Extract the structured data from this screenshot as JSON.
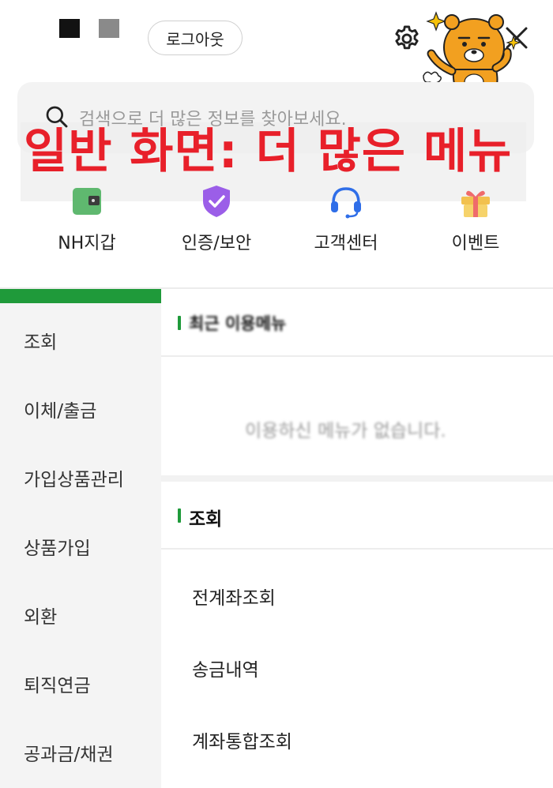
{
  "header": {
    "logout_label": "로그아웃"
  },
  "search": {
    "placeholder": "검색으로 더 많은 정보를 찾아보세요."
  },
  "banner": {
    "text": "일반 화면: 더 많은 메뉴"
  },
  "quick_menu": [
    {
      "label": "NH지갑",
      "icon": "wallet-icon",
      "color": "#5fb86f"
    },
    {
      "label": "인증/보안",
      "icon": "shield-check-icon",
      "color": "#9b5ee8"
    },
    {
      "label": "고객센터",
      "icon": "headset-icon",
      "color": "#2f6ee8"
    },
    {
      "label": "이벤트",
      "icon": "gift-icon",
      "color": "#f2c14e"
    }
  ],
  "sidebar": {
    "items": [
      {
        "label": "조회"
      },
      {
        "label": "이체/출금"
      },
      {
        "label": "가입상품관리"
      },
      {
        "label": "상품가입"
      },
      {
        "label": "외환"
      },
      {
        "label": "퇴직연금"
      },
      {
        "label": "공과금/채권"
      }
    ]
  },
  "main": {
    "recent_title": "최근 이용메뉴",
    "empty_message": "이용하신 메뉴가 없습니다.",
    "section_title": "조회",
    "sub_items": [
      {
        "label": "전계좌조회"
      },
      {
        "label": "송금내역"
      },
      {
        "label": "계좌통합조회"
      }
    ]
  },
  "colors": {
    "accent_green": "#1f9a3a",
    "banner_red": "#e8202a"
  }
}
